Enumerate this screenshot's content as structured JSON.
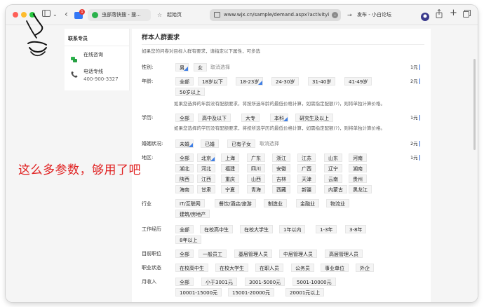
{
  "browser": {
    "tabs": [
      {
        "label": "虫部落快搜 - 搜...",
        "badge": "1"
      },
      {
        "label": "起始页"
      },
      {
        "label": "www.wjx.cn/sample/demand.aspx?activityid..."
      },
      {
        "label": "发布 - 小白论坛"
      }
    ]
  },
  "sidebar": {
    "title": "联系专员",
    "consult": "在线咨询",
    "hotline_label": "电话专线",
    "hotline_number": "400-900-3327"
  },
  "main": {
    "title": "样本人群要求",
    "subtitle": "如果您的问卷对目标人群有要求，请指定以下属性，可多选",
    "gender": {
      "label": "性别:",
      "options": [
        "男",
        "女"
      ],
      "cancel": "取消选择",
      "price": "1元"
    },
    "age": {
      "label": "年龄:",
      "options": [
        "全部",
        "18岁以下",
        "18-23岁",
        "24-30岁",
        "31-40岁",
        "41-49岁",
        "50岁以上"
      ],
      "price": "2元",
      "note": "如果您选择的年龄没有配额要求，将按所选年龄的最低价格计算，如需指定配额(?)，则将单独计算价格。"
    },
    "education": {
      "label": "学历:",
      "options": [
        "全部",
        "高中及以下",
        "大专",
        "本科",
        "研究生及以上"
      ],
      "price": "1元",
      "note": "如果您选择的学历没有配额要求，将按所选学历的最低价格计算，如需指定配额(?)，则将单独计算价格。"
    },
    "marital": {
      "label": "婚姻状况:",
      "options": [
        "未婚",
        "已婚",
        "已有子女"
      ],
      "cancel": "取消选择",
      "price": "2元"
    },
    "region": {
      "label": "地区:",
      "price": "1元",
      "rows": [
        [
          "全部",
          "北京",
          "上海",
          "广东",
          "浙江",
          "江苏",
          "山东",
          "河南"
        ],
        [
          "湖北",
          "河北",
          "福建",
          "四川",
          "安徽",
          "广西",
          "辽宁",
          "湖南"
        ],
        [
          "陕西",
          "江西",
          "重庆",
          "山西",
          "吉林",
          "天津",
          "云南",
          "贵州"
        ],
        [
          "海南",
          "甘肃",
          "宁夏",
          "青海",
          "西藏",
          "新疆",
          "内蒙古",
          "黑龙江"
        ]
      ]
    },
    "industry": {
      "label": "行业",
      "options": [
        "IT/互联网",
        "餐饮/酒店/旅游",
        "制造业",
        "金融业",
        "物流业",
        "建筑/房地产"
      ]
    },
    "experience": {
      "label": "工作经历",
      "options": [
        "全部",
        "在校高中生",
        "在校大学生",
        "1年以内",
        "1-3年",
        "3-8年",
        "8年以上"
      ]
    },
    "position": {
      "label": "目前职位",
      "options": [
        "全部",
        "一般员工",
        "基层管理人员",
        "中层管理人员",
        "高层管理人员"
      ]
    },
    "occupation": {
      "label": "职业状态",
      "options": [
        "在校高中生",
        "在校大学生",
        "在职人员",
        "公务员",
        "事业单位",
        "外企"
      ]
    },
    "income": {
      "label": "月收入",
      "options": [
        "全部",
        "小于3001元",
        "3001-5000元",
        "5001-10000元",
        "10001-15000元",
        "15001-20000元",
        "20001元以上"
      ]
    }
  },
  "annotation": "这么多参数，够用了吧",
  "colors": {
    "accent": "#2f6de0",
    "annotation": "#e02020"
  }
}
